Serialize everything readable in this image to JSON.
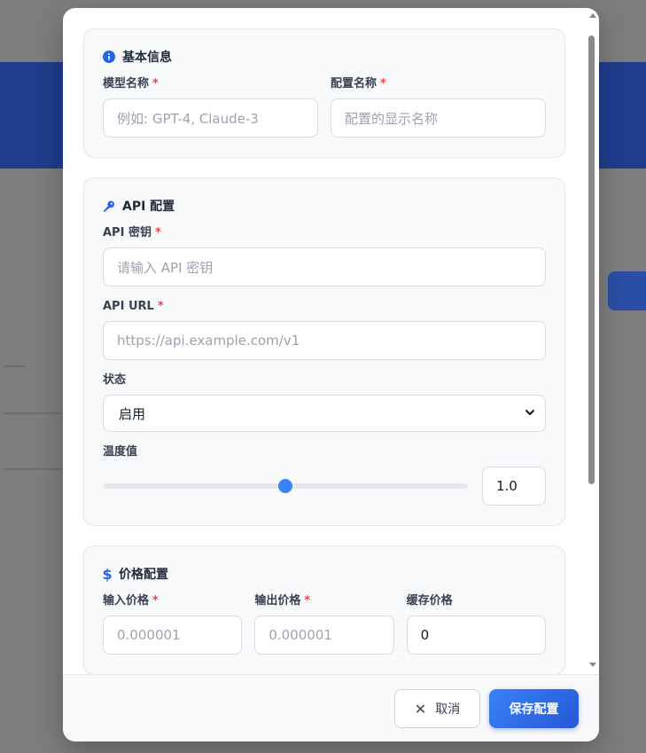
{
  "colors": {
    "accent": "#3b82f6",
    "required": "#ef4444",
    "title": "#1f2937"
  },
  "basic_info": {
    "title": "基本信息",
    "icon": "info-circle-icon",
    "model_name": {
      "label": "模型名称",
      "required": "*",
      "placeholder": "例如: GPT-4, Claude-3"
    },
    "config_name": {
      "label": "配置名称",
      "required": "*",
      "placeholder": "配置的显示名称"
    }
  },
  "api_config": {
    "title": "API 配置",
    "icon": "key-icon",
    "api_key": {
      "label": "API 密钥",
      "required": "*",
      "placeholder": "请输入 API 密钥"
    },
    "api_url": {
      "label": "API URL",
      "required": "*",
      "placeholder": "https://api.example.com/v1"
    },
    "status": {
      "label": "状态",
      "value": "启用"
    },
    "temperature": {
      "label": "温度值",
      "value": "1.0",
      "fraction": 0.5
    }
  },
  "price_config": {
    "title": "价格配置",
    "icon": "dollar-icon",
    "input_price": {
      "label": "输入价格",
      "required": "*",
      "placeholder": "0.000001"
    },
    "output_price": {
      "label": "输出价格",
      "required": "*",
      "placeholder": "0.000001"
    },
    "cache_price": {
      "label": "缓存价格",
      "value": "0"
    }
  },
  "footer": {
    "cancel_label": "取消",
    "save_label": "保存配置"
  }
}
